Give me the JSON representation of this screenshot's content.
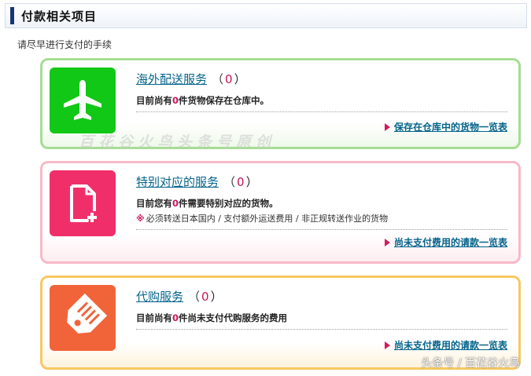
{
  "header": {
    "title": "付款相关项目"
  },
  "subtitle": "请尽早进行支付的手续",
  "cards": [
    {
      "icon": "airplane-icon",
      "title": "海外配送服务",
      "paren_open": "（",
      "count": "0",
      "paren_close": "）",
      "desc_prefix": "目前尚有",
      "desc_number": "0",
      "desc_suffix": "件货物保存在仓库中。",
      "link": "保存在仓库中的货物一览表",
      "color": "#12c816"
    },
    {
      "icon": "document-add-icon",
      "title": "特别对应的服务",
      "paren_open": "（",
      "count": "0",
      "paren_close": "）",
      "desc_prefix": "目前您有",
      "desc_number": "0",
      "desc_suffix": "件需要特别对应的货物。",
      "note_mark": "※",
      "note": "必须转送日本国内 / 支付额外运送费用 / 非正规转送作业的货物",
      "link": "尚未支付费用的请款一览表",
      "color": "#f02f6a"
    },
    {
      "icon": "price-tag-icon",
      "title": "代购服务",
      "paren_open": "（",
      "count": "0",
      "paren_close": "）",
      "desc_prefix": "目前尚有",
      "desc_number": "0",
      "desc_suffix": "件尚未支付代购服务的费用",
      "link": "尚未支付费用的请款一览表",
      "color": "#f1643a"
    }
  ],
  "watermarks": {
    "center": "百花谷火鸟头条号原创",
    "corner": "头条号 / 百花谷火鸟"
  }
}
